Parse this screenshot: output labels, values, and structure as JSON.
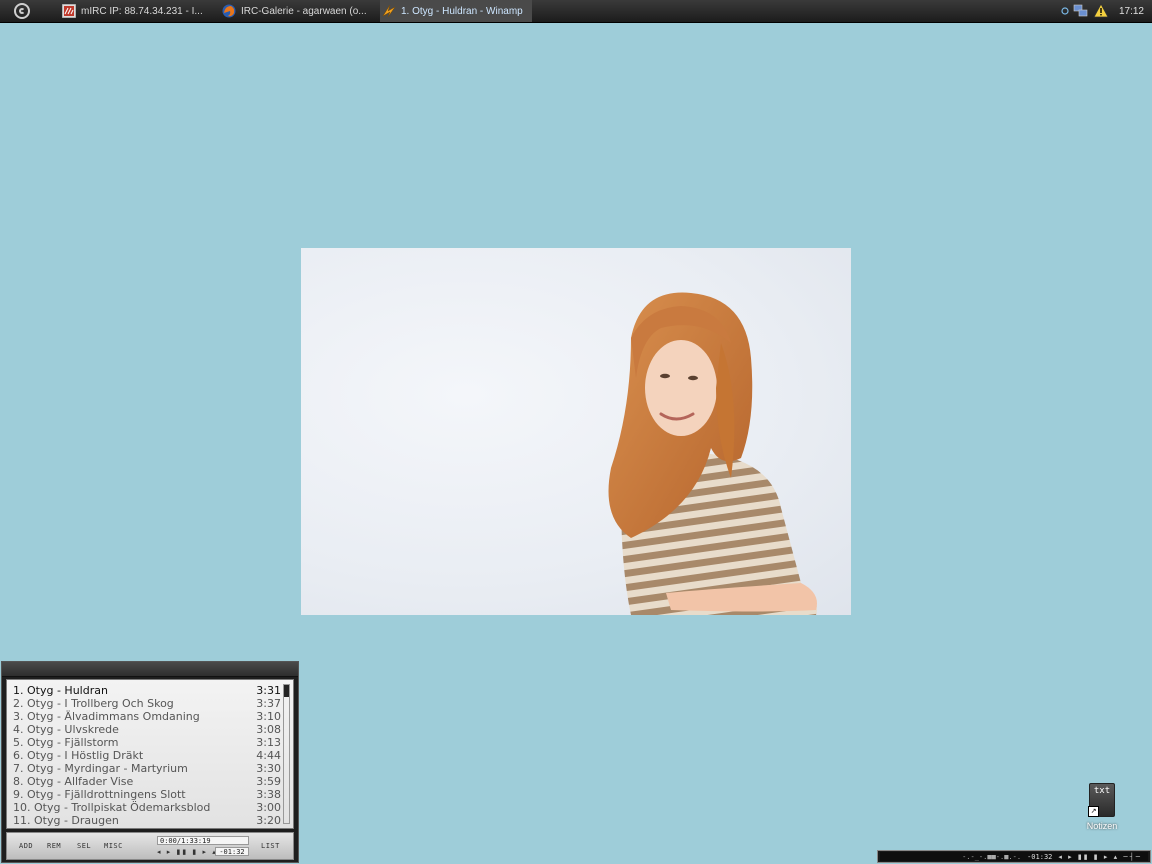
{
  "taskbar": {
    "tasks": [
      {
        "label": "mIRC IP: 88.74.34.231 - I...",
        "icon": "mirc-icon"
      },
      {
        "label": "IRC-Galerie - agarwaen (o...",
        "icon": "firefox-icon"
      },
      {
        "label": "1. Otyg - Huldran - Winamp",
        "icon": "winamp-icon"
      }
    ],
    "clock": "17:12"
  },
  "playlist": {
    "tracks": [
      {
        "label": "1. Otyg - Huldran",
        "duration": "3:31"
      },
      {
        "label": "2. Otyg - I Trollberg Och Skog",
        "duration": "3:37"
      },
      {
        "label": "3. Otyg - Älvadimmans Omdaning",
        "duration": "3:10"
      },
      {
        "label": "4. Otyg - Ulvskrede",
        "duration": "3:08"
      },
      {
        "label": "5. Otyg - Fjällstorm",
        "duration": "3:13"
      },
      {
        "label": "6. Otyg - I Höstlig Dräkt",
        "duration": "4:44"
      },
      {
        "label": "7. Otyg - Myrdingar - Martyrium",
        "duration": "3:30"
      },
      {
        "label": "8. Otyg - Allfader Vise",
        "duration": "3:59"
      },
      {
        "label": "9. Otyg - Fjälldrottningens Slott",
        "duration": "3:38"
      },
      {
        "label": "10. Otyg - Trollpiskat Ödemarksblod",
        "duration": "3:00"
      },
      {
        "label": "11. Otyg - Draugen",
        "duration": "3:20"
      }
    ],
    "buttons": {
      "add": "ADD",
      "rem": "REM",
      "sel": "SEL",
      "misc": "MISC",
      "list": "LIST"
    },
    "time_total": "0:00/1:33:19",
    "time_remaining": "-01:32"
  },
  "miniplayer": {
    "vis": "-.-_-.■■-.■.-.",
    "time": "-01:32"
  },
  "desktop_icon": {
    "glyph": "txt",
    "label": "Notizen"
  },
  "colors": {
    "desktop": "#9ecdd9",
    "taskbar": "#1c1c1c",
    "active_task_text": "#cde6ff"
  }
}
